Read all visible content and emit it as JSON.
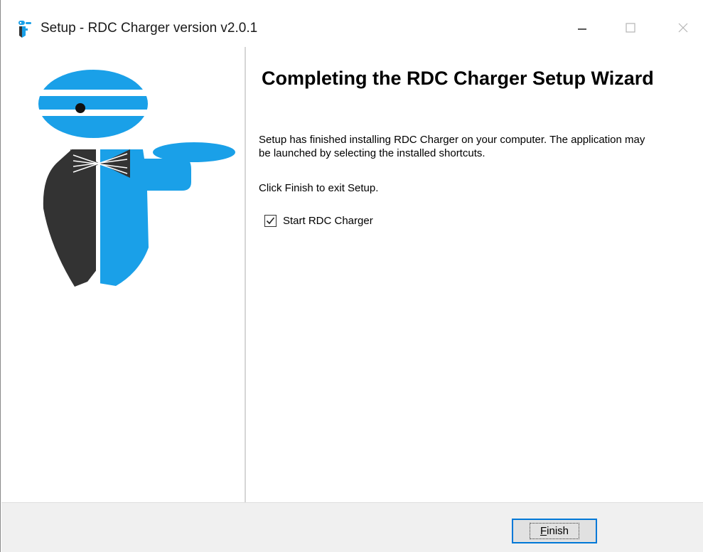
{
  "window": {
    "title": "Setup - RDC Charger version v2.0.1",
    "title_icon": "installer-app-icon",
    "controls": {
      "minimize_icon": "minimize-icon",
      "maximize_icon": "maximize-icon",
      "close_icon": "close-icon"
    }
  },
  "sidebar": {
    "logo_icon": "waiter-logo-icon",
    "colors": {
      "blue": "#1aa0e8",
      "dark": "#333333"
    }
  },
  "content": {
    "heading": "Completing the RDC Charger Setup Wizard",
    "body": "Setup has finished installing RDC Charger on your computer. The application may be launched by selecting the installed shortcuts.",
    "instruction": "Click Finish to exit Setup.",
    "start_checkbox": {
      "label": "Start RDC Charger",
      "checked": true
    }
  },
  "footer": {
    "finish_label": "Finish"
  },
  "colors": {
    "accent": "#0078d7",
    "footer_bg": "#f0f0f0"
  }
}
